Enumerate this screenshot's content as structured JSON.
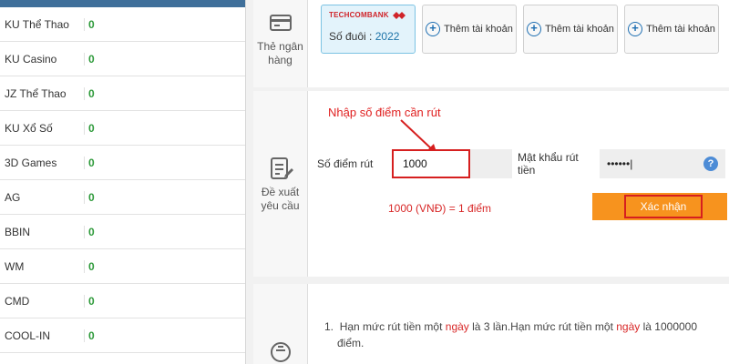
{
  "sidebar": {
    "items": [
      {
        "name": "KU Thể Thao",
        "amount": "0"
      },
      {
        "name": "KU Casino",
        "amount": "0"
      },
      {
        "name": "JZ Thể Thao",
        "amount": "0"
      },
      {
        "name": "KU Xổ Số",
        "amount": "0"
      },
      {
        "name": "3D Games",
        "amount": "0"
      },
      {
        "name": "AG",
        "amount": "0"
      },
      {
        "name": "BBIN",
        "amount": "0"
      },
      {
        "name": "WM",
        "amount": "0"
      },
      {
        "name": "CMD",
        "amount": "0"
      },
      {
        "name": "COOL-IN",
        "amount": "0"
      }
    ]
  },
  "bank_section": {
    "label": "Thẻ ngân hàng",
    "icon": "bank-card-icon",
    "bank_card": {
      "bank_name": "TECHCOMBANK",
      "suffix_label": "Số đuôi :",
      "suffix_value": "2022"
    },
    "add_account_label": "Thêm tài khoản"
  },
  "request_section": {
    "label": "Đề xuất yêu cầu",
    "icon": "request-form-icon",
    "annotation": "Nhập số điểm cần rút",
    "points_label": "Số điểm rút",
    "points_value": "1000",
    "password_label": "Mật khẩu rút tiền",
    "password_value": "••••••|",
    "help_label": "?",
    "rate_text": "1000 (VNĐ) = 1 điểm",
    "confirm_label": "Xác nhận"
  },
  "notes_section": {
    "icon": "notice-icon",
    "note_1_num": "1.",
    "note_1_a": "Hạn mức rút tiền một",
    "note_1_day1": "ngày",
    "note_1_b": "là 3 lần.Hạn mức rút tiền một",
    "note_1_day2": "ngày",
    "note_1_c": "là 1000000",
    "note_1_d": "điểm."
  },
  "colors": {
    "accent_orange": "#f7931e",
    "highlight_red": "#d61f1f",
    "amount_green": "#2e9a3a",
    "link_blue": "#1f6fb2"
  }
}
